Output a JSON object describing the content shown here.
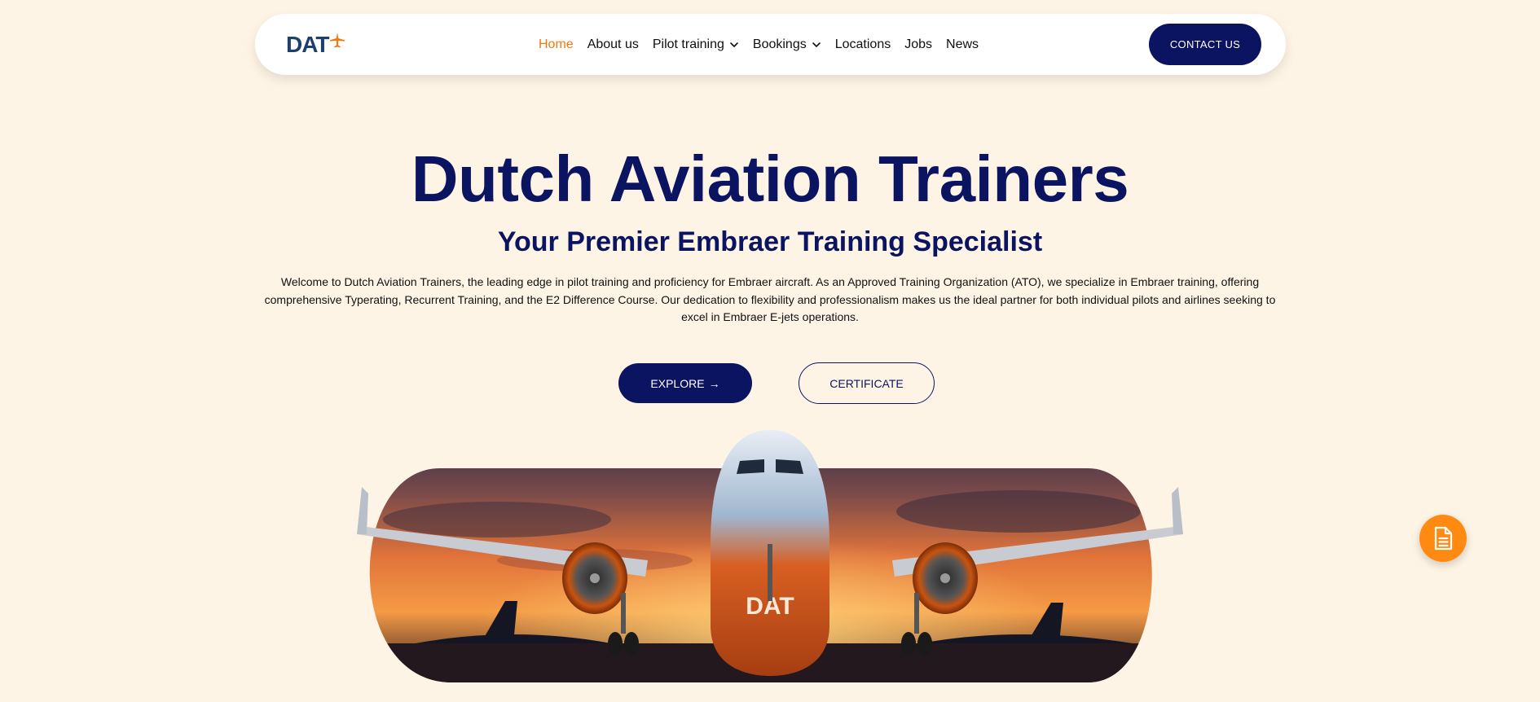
{
  "brand": {
    "logo_text": "DAT"
  },
  "nav": {
    "items": [
      {
        "label": "Home",
        "active": true,
        "dropdown": false
      },
      {
        "label": "About us",
        "active": false,
        "dropdown": false
      },
      {
        "label": "Pilot training",
        "active": false,
        "dropdown": true
      },
      {
        "label": "Bookings",
        "active": false,
        "dropdown": true
      },
      {
        "label": "Locations",
        "active": false,
        "dropdown": false
      },
      {
        "label": "Jobs",
        "active": false,
        "dropdown": false
      },
      {
        "label": "News",
        "active": false,
        "dropdown": false
      }
    ],
    "contact_label": "CONTACT US"
  },
  "hero": {
    "title": "Dutch Aviation Trainers",
    "subtitle": "Your Premier Embraer Training Specialist",
    "description": "Welcome to Dutch Aviation Trainers, the leading edge in pilot training and proficiency for Embraer aircraft. As an Approved Training Organization (ATO), we specialize in Embraer training, offering comprehensive Typerating, Recurrent Training, and the E2 Difference Course. Our dedication to flexibility and professionalism makes us the ideal partner for both individual pilots and airlines seeking to excel in Embraer E-jets operations.",
    "explore_label": "EXPLORE",
    "certificate_label": "CERTIFICATE",
    "image_text": "DAT"
  },
  "icons": {
    "logo_plane": "plane-icon",
    "dropdown": "chevron-down-icon",
    "explore_arrow": "arrow-right-icon",
    "floating": "document-icon"
  },
  "colors": {
    "background": "#fef4e5",
    "navy": "#0b1460",
    "accent_orange": "#f07a10",
    "floating_orange": "#ff8a12",
    "logo_blue": "#1d3f6e"
  }
}
